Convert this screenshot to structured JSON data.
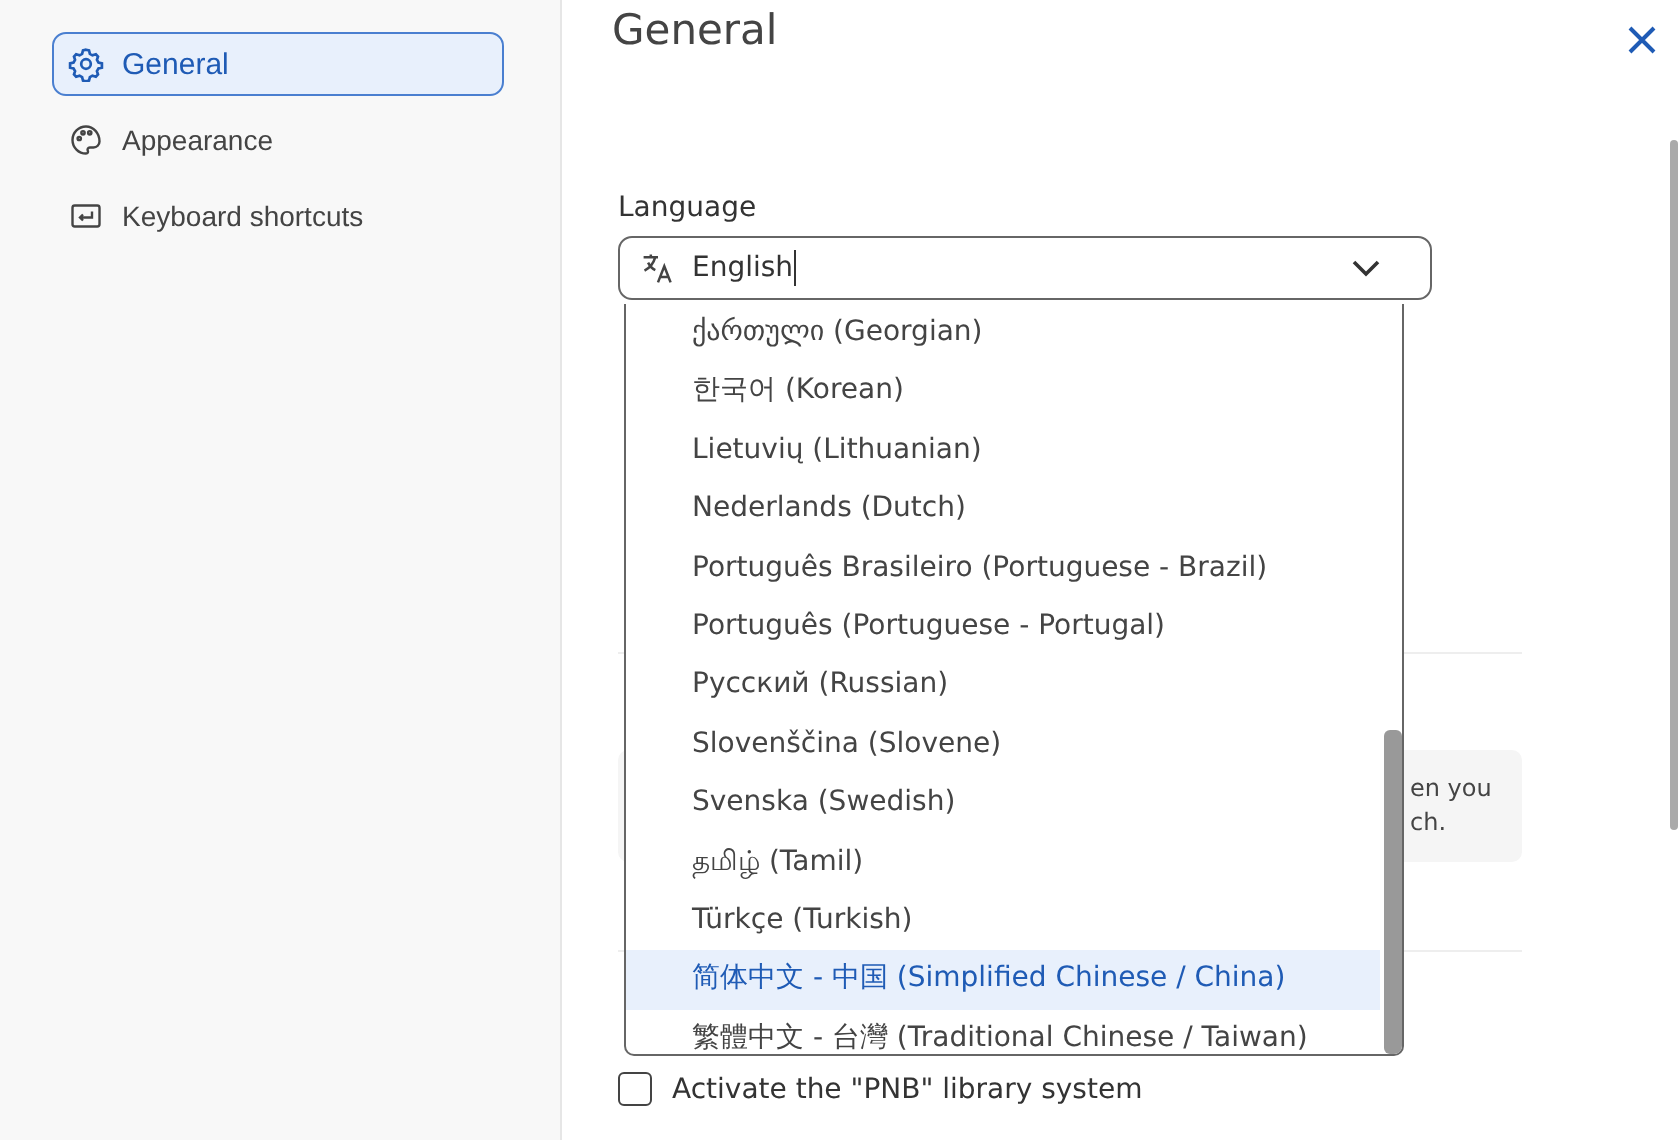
{
  "sidebar": {
    "items": [
      {
        "label": "General",
        "kind": "gear",
        "selected": true
      },
      {
        "label": "Appearance",
        "kind": "palette",
        "selected": false
      },
      {
        "label": "Keyboard shortcuts",
        "kind": "enter",
        "selected": false
      }
    ]
  },
  "page": {
    "title": "General"
  },
  "language": {
    "label": "Language",
    "value": "English",
    "expanded": true,
    "options": [
      {
        "label": "ქართული (Georgian)",
        "selected": false
      },
      {
        "label": "한국어 (Korean)",
        "selected": false
      },
      {
        "label": "Lietuvių (Lithuanian)",
        "selected": false
      },
      {
        "label": "Nederlands (Dutch)",
        "selected": false
      },
      {
        "label": "Português Brasileiro (Portuguese - Brazil)",
        "selected": false
      },
      {
        "label": "Português (Portuguese - Portugal)",
        "selected": false
      },
      {
        "label": "Русский (Russian)",
        "selected": false
      },
      {
        "label": "Slovenščina (Slovene)",
        "selected": false
      },
      {
        "label": "Svenska (Swedish)",
        "selected": false
      },
      {
        "label": "தமிழ் (Tamil)",
        "selected": false
      },
      {
        "label": "Türkçe (Turkish)",
        "selected": false
      },
      {
        "label": "简体中文 - 中国 (Simplified Chinese / China)",
        "selected": true
      },
      {
        "label": "繁體中文 - 台灣 (Traditional Chinese / Taiwan)",
        "selected": false
      }
    ]
  },
  "note": {
    "lines": [
      "en you",
      "ch."
    ]
  },
  "library_option": {
    "label": "Activate the \"PNB\" library system",
    "checked": false
  }
}
